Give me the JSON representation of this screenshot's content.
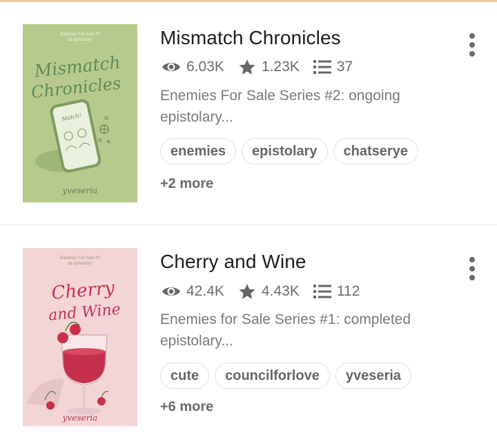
{
  "accent_color": "#f3c9a4",
  "stories": [
    {
      "title": "Mismatch Chronicles",
      "cover": {
        "bg": "#b5c98c",
        "series_line": "Enemies For Sale #2",
        "subtitle_line": "an epistolary",
        "title_line1": "Mismatch",
        "title_line2": "Chronicles",
        "phone_text": "Match!",
        "author": "yveseria"
      },
      "views": "6.03K",
      "votes": "1.23K",
      "parts": "37",
      "description": "Enemies For Sale Series #2: ongoing epistolary...",
      "tags": [
        "enemies",
        "epistolary",
        "chatserye"
      ],
      "more_tags": "+2 more",
      "icons": {
        "views": "eye-icon",
        "votes": "star-icon",
        "parts": "list-icon",
        "menu": "more-vertical-icon"
      }
    },
    {
      "title": "Cherry and Wine",
      "cover": {
        "bg": "#f3d3d6",
        "series_line": "Enemies For Sale #1",
        "subtitle_line": "an epistolary",
        "title_line1": "Cherry",
        "title_line2": "and Wine",
        "author": "yveseria"
      },
      "views": "42.4K",
      "votes": "4.43K",
      "parts": "112",
      "description": "Enemies for Sale Series #1: completed epistolary...",
      "tags": [
        "cute",
        "councilforlove",
        "yveseria"
      ],
      "more_tags": "+6 more",
      "icons": {
        "views": "eye-icon",
        "votes": "star-icon",
        "parts": "list-icon",
        "menu": "more-vertical-icon"
      }
    }
  ]
}
